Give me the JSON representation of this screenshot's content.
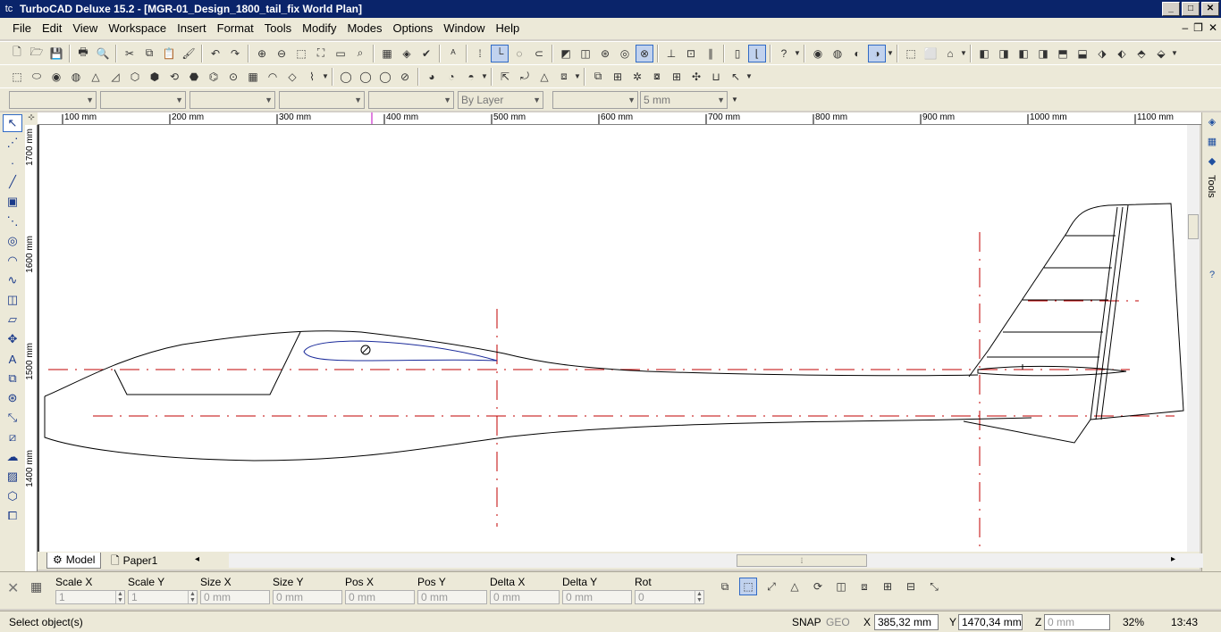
{
  "window": {
    "app_icon": "tc",
    "title": "TurboCAD Deluxe 15.2 - [MGR-01_Design_1800_tail_fix World Plan]",
    "buttons": [
      "_",
      "□",
      "✕"
    ],
    "mdi_buttons": [
      "–",
      "❐",
      "✕"
    ]
  },
  "menu": [
    "File",
    "Edit",
    "View",
    "Workspace",
    "Insert",
    "Format",
    "Tools",
    "Modify",
    "Modes",
    "Options",
    "Window",
    "Help"
  ],
  "property_bar": {
    "layer_value": "By Layer",
    "pen_width_value": "5 mm"
  },
  "rulers": {
    "horizontal_labels": [
      "100 mm",
      "200 mm",
      "300 mm",
      "400 mm",
      "500 mm",
      "600 mm",
      "700 mm",
      "800 mm",
      "900 mm",
      "1000 mm",
      "1100 mm"
    ],
    "vertical_labels": [
      "1700 mm",
      "1600 mm",
      "1500 mm",
      "1400 mm"
    ]
  },
  "right_panel": {
    "label": "Tools"
  },
  "tabs": [
    {
      "label": "Model",
      "active": true
    },
    {
      "label": "Paper1",
      "active": false
    }
  ],
  "inspector": {
    "fields": [
      {
        "label": "Scale X",
        "value": "1"
      },
      {
        "label": "Scale Y",
        "value": "1"
      },
      {
        "label": "Size X",
        "value": "0 mm"
      },
      {
        "label": "Size Y",
        "value": "0 mm"
      },
      {
        "label": "Pos X",
        "value": "0 mm"
      },
      {
        "label": "Pos Y",
        "value": "0 mm"
      },
      {
        "label": "Delta X",
        "value": "0 mm"
      },
      {
        "label": "Delta Y",
        "value": "0 mm"
      },
      {
        "label": "Rot",
        "value": "0"
      }
    ]
  },
  "status": {
    "message": "Select object(s)",
    "snap": "SNAP",
    "geo": "GEO",
    "x_label": "X",
    "x_value": "385,32 mm",
    "y_label": "Y",
    "y_value": "1470,34 mm",
    "z_label": "Z",
    "z_value": "0 mm",
    "zoom": "32%",
    "time": "13:43"
  }
}
